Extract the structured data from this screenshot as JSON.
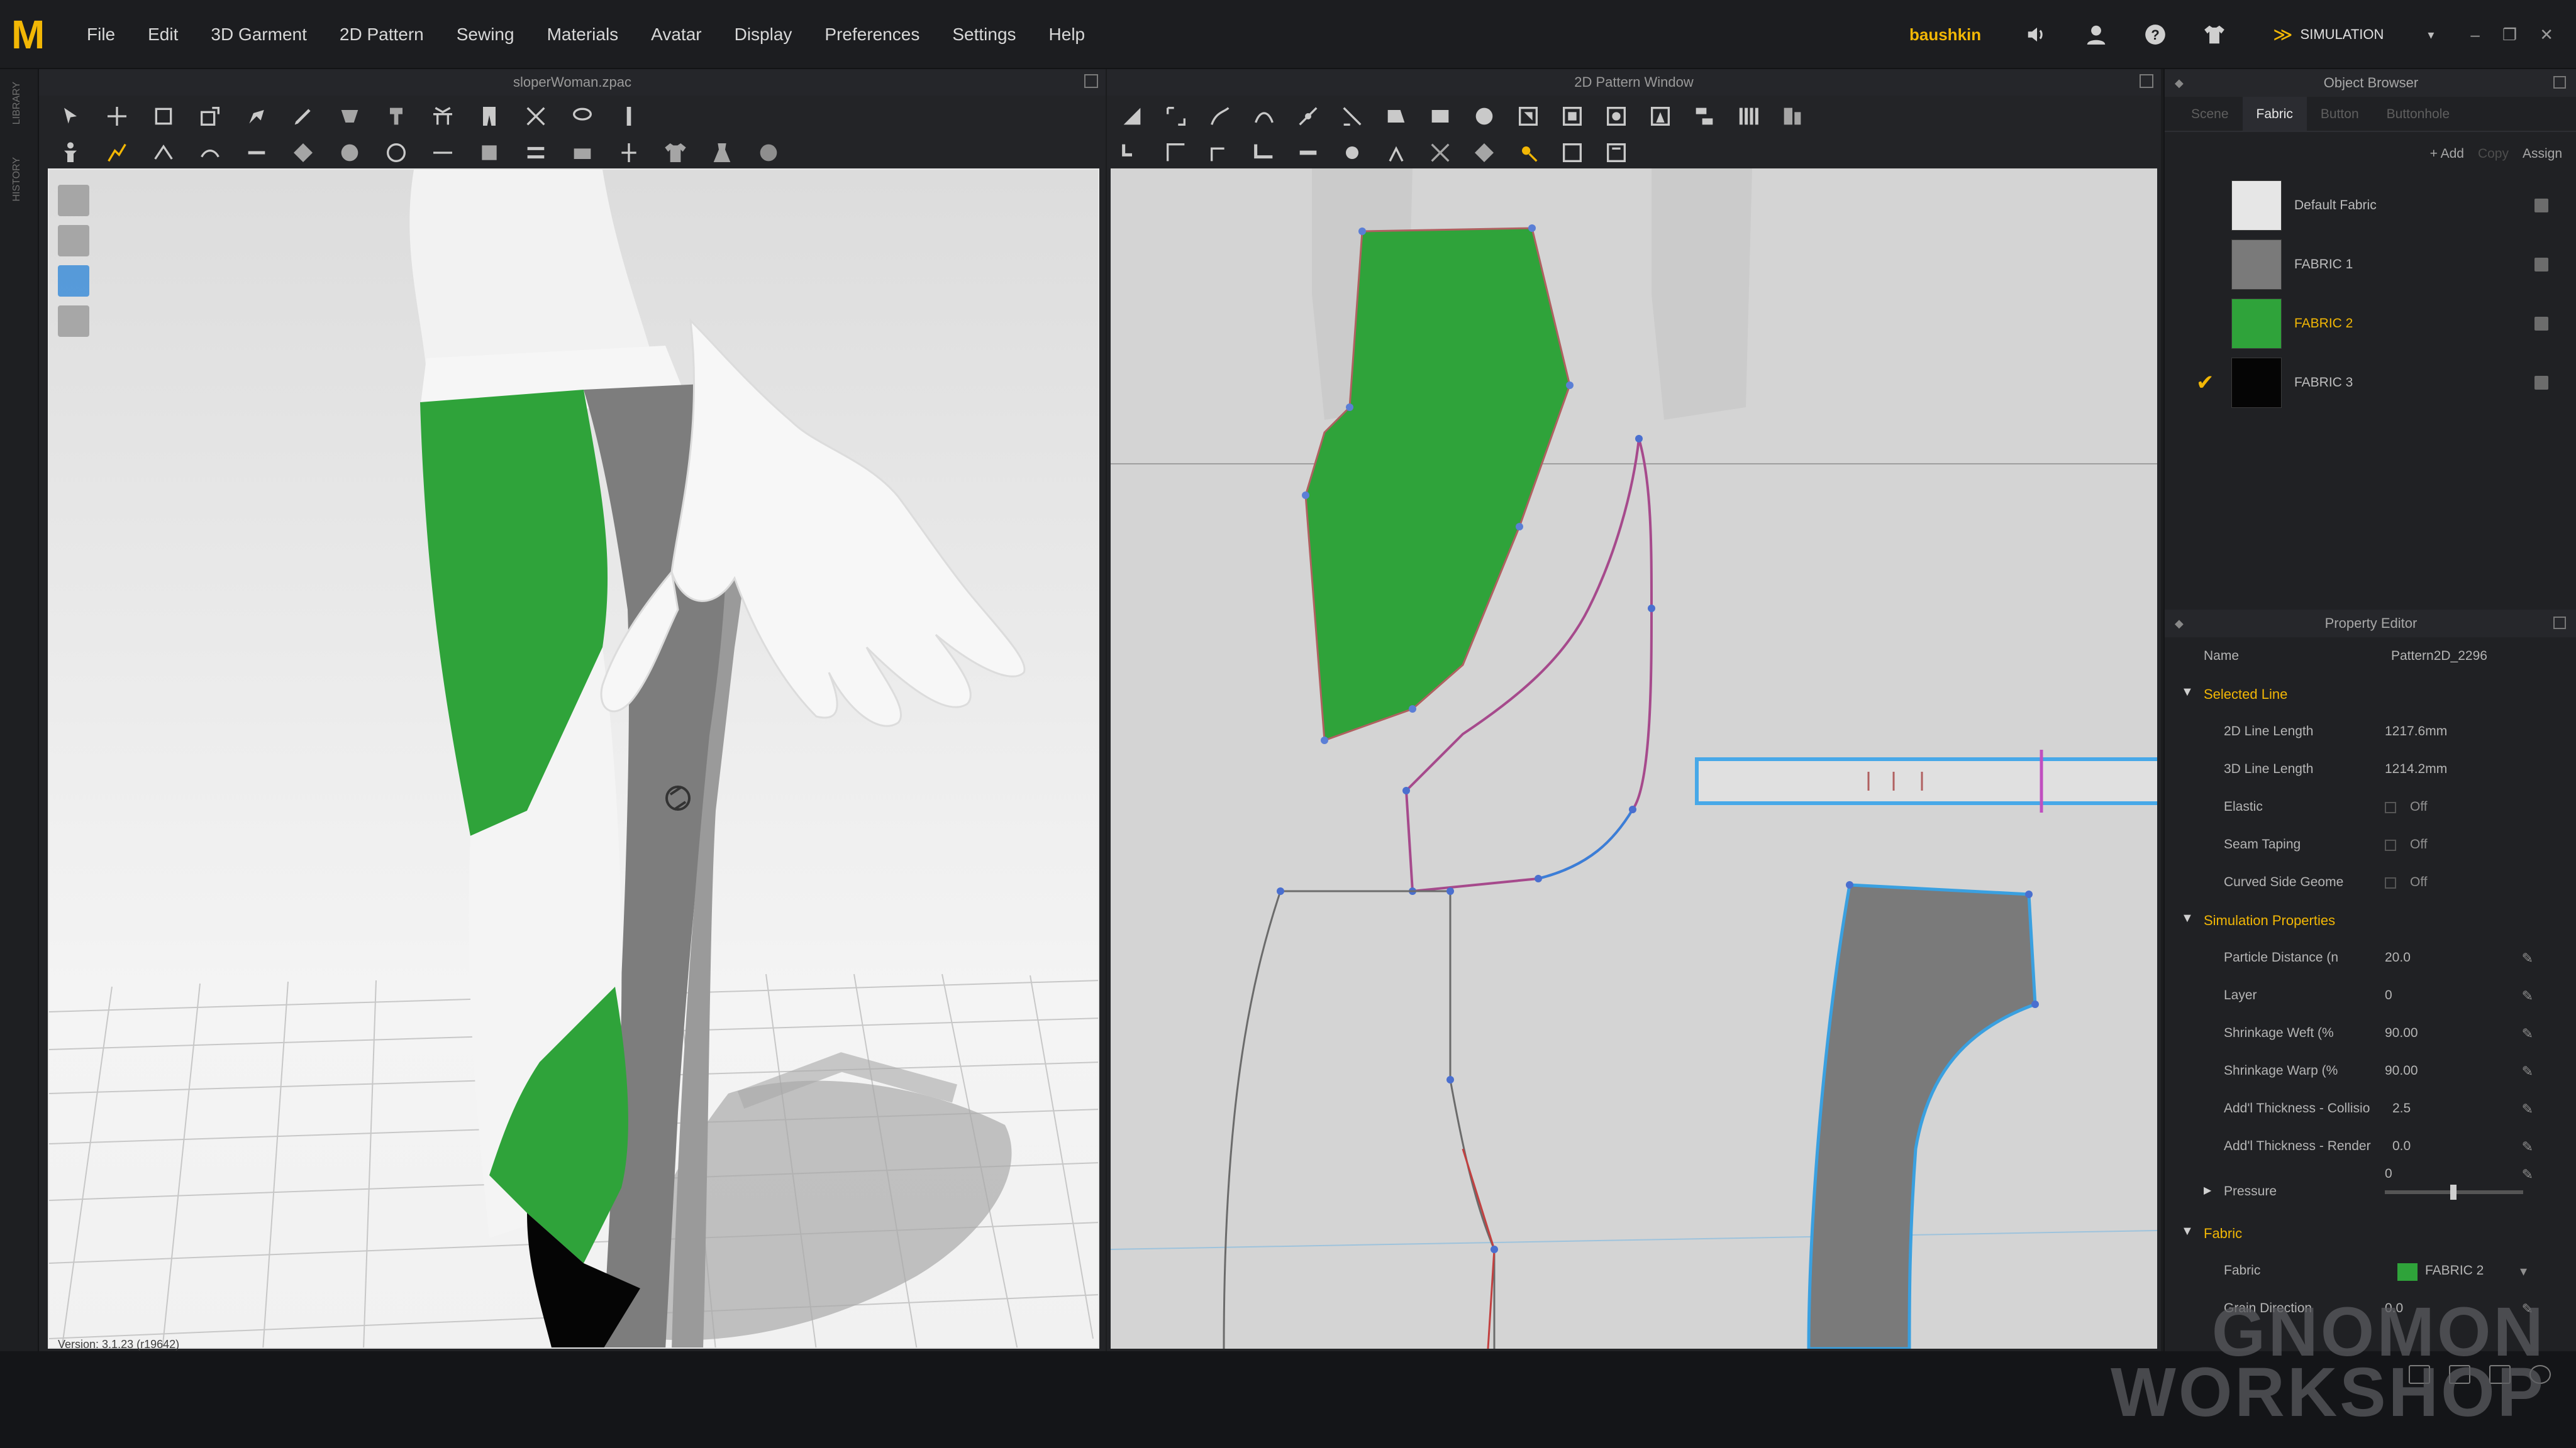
{
  "menu": {
    "logo": "M",
    "items": [
      "File",
      "Edit",
      "3D Garment",
      "2D Pattern",
      "Sewing",
      "Materials",
      "Avatar",
      "Display",
      "Preferences",
      "Settings",
      "Help"
    ]
  },
  "user": {
    "name": "baushkin",
    "mode_label": "SIMULATION"
  },
  "panel_3d": {
    "title": "sloperWoman.zpac",
    "version_text": "Version: 3.1.23    (r19642)"
  },
  "panel_2d": {
    "title": "2D Pattern Window"
  },
  "left_strip": {
    "tabs": [
      "LIBRARY",
      "HISTORY"
    ]
  },
  "object_browser": {
    "title": "Object Browser",
    "tabs": [
      "Scene",
      "Fabric",
      "Button",
      "Buttonhole"
    ],
    "active_tab": "Fabric",
    "actions": {
      "add": "+ Add",
      "copy": "Copy",
      "assign": "Assign"
    },
    "fabrics": [
      {
        "name": "Default Fabric",
        "color": "#e6e6e6",
        "selected": false,
        "checked": false
      },
      {
        "name": "FABRIC 1",
        "color": "#7a7a7a",
        "selected": false,
        "checked": false
      },
      {
        "name": "FABRIC 2",
        "color": "#2fa33a",
        "selected": true,
        "checked": false
      },
      {
        "name": "FABRIC 3",
        "color": "#050505",
        "selected": false,
        "checked": true
      }
    ]
  },
  "property_editor": {
    "title": "Property Editor",
    "name_label": "Name",
    "name_value": "Pattern2D_2296",
    "selected_line": {
      "label": "Selected Line",
      "line_2d_label": "2D Line Length",
      "line_2d_value": "1217.6mm",
      "line_3d_label": "3D Line Length",
      "line_3d_value": "1214.2mm",
      "elastic_label": "Elastic",
      "elastic_value": "Off",
      "seam_label": "Seam Taping",
      "seam_value": "Off",
      "curved_label": "Curved Side Geome",
      "curved_value": "Off"
    },
    "simulation": {
      "label": "Simulation Properties",
      "particle_label": "Particle Distance (n",
      "particle_value": "20.0",
      "layer_label": "Layer",
      "layer_value": "0",
      "weft_label": "Shrinkage Weft (%",
      "weft_value": "90.00",
      "warp_label": "Shrinkage Warp (%",
      "warp_value": "90.00",
      "collision_label": "Add'l Thickness - Collisio",
      "collision_value": "2.5",
      "render_label": "Add'l Thickness - Render",
      "render_value": "0.0",
      "pressure_label": "Pressure",
      "pressure_value": "0"
    },
    "fabric": {
      "label": "Fabric",
      "fabric_label": "Fabric",
      "fabric_value": "FABRIC 2",
      "fabric_color": "#2fa33a",
      "grain_label": "Grain Direction",
      "grain_value": "0.0"
    }
  },
  "watermark": {
    "line1": "GNOMON",
    "line2": "WORKSHOP"
  },
  "colors": {
    "accent": "#f2b705",
    "fabric_green": "#2fa33a",
    "fabric_gray": "#7a7a7a",
    "pattern_bg": "#d4d4d4"
  }
}
